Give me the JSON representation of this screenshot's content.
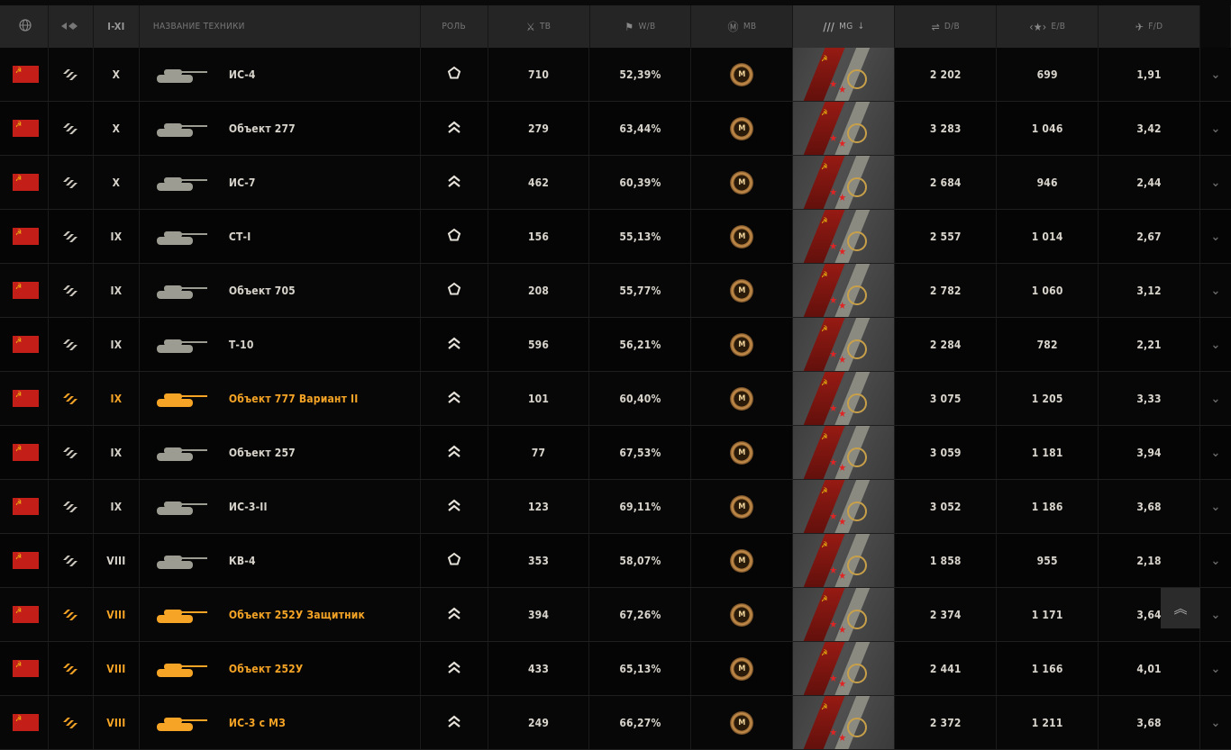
{
  "header": {
    "nation_icon": "globe-icon",
    "type_icon": "vehicle-type-icon",
    "tier_label": "I-XI",
    "name_label": "Название техники",
    "role_label": "Роль",
    "battles_label": "ТВ",
    "winrate_label": "W/B",
    "mastery_label": "MB",
    "marks_label": "MG",
    "damage_label": "D/B",
    "exp_label": "E/B",
    "frags_label": "F/D"
  },
  "colors": {
    "premium": "#f5a425",
    "standard": "#d8d4cc",
    "header_bg": "#252525"
  },
  "rows": [
    {
      "tier": "X",
      "name": "ИС-4",
      "role": "heavy-armor",
      "battles": "710",
      "winrate": "52,39%",
      "mastery": "M",
      "damage": "2 202",
      "exp": "699",
      "frags": "1,91",
      "premium": false
    },
    {
      "tier": "X",
      "name": "Объект 277",
      "role": "heavy-assault",
      "battles": "279",
      "winrate": "63,44%",
      "mastery": "M",
      "damage": "3 283",
      "exp": "1 046",
      "frags": "3,42",
      "premium": false
    },
    {
      "tier": "X",
      "name": "ИС-7",
      "role": "heavy-assault",
      "battles": "462",
      "winrate": "60,39%",
      "mastery": "M",
      "damage": "2 684",
      "exp": "946",
      "frags": "2,44",
      "premium": false
    },
    {
      "tier": "IX",
      "name": "СТ-I",
      "role": "heavy-armor",
      "battles": "156",
      "winrate": "55,13%",
      "mastery": "M",
      "damage": "2 557",
      "exp": "1 014",
      "frags": "2,67",
      "premium": false
    },
    {
      "tier": "IX",
      "name": "Объект 705",
      "role": "heavy-armor",
      "battles": "208",
      "winrate": "55,77%",
      "mastery": "M",
      "damage": "2 782",
      "exp": "1 060",
      "frags": "3,12",
      "premium": false
    },
    {
      "tier": "IX",
      "name": "Т-10",
      "role": "heavy-assault",
      "battles": "596",
      "winrate": "56,21%",
      "mastery": "M",
      "damage": "2 284",
      "exp": "782",
      "frags": "2,21",
      "premium": false
    },
    {
      "tier": "IX",
      "name": "Объект 777 Вариант II",
      "role": "heavy-assault",
      "battles": "101",
      "winrate": "60,40%",
      "mastery": "M",
      "damage": "3 075",
      "exp": "1 205",
      "frags": "3,33",
      "premium": true
    },
    {
      "tier": "IX",
      "name": "Объект 257",
      "role": "heavy-assault",
      "battles": "77",
      "winrate": "67,53%",
      "mastery": "M",
      "damage": "3 059",
      "exp": "1 181",
      "frags": "3,94",
      "premium": false
    },
    {
      "tier": "IX",
      "name": "ИС-3-II",
      "role": "heavy-assault",
      "battles": "123",
      "winrate": "69,11%",
      "mastery": "M",
      "damage": "3 052",
      "exp": "1 186",
      "frags": "3,68",
      "premium": false
    },
    {
      "tier": "VIII",
      "name": "КВ-4",
      "role": "heavy-armor",
      "battles": "353",
      "winrate": "58,07%",
      "mastery": "M",
      "damage": "1 858",
      "exp": "955",
      "frags": "2,18",
      "premium": false
    },
    {
      "tier": "VIII",
      "name": "Объект 252У Защитник",
      "role": "heavy-assault",
      "battles": "394",
      "winrate": "67,26%",
      "mastery": "M",
      "damage": "2 374",
      "exp": "1 171",
      "frags": "3,64",
      "premium": true
    },
    {
      "tier": "VIII",
      "name": "Объект 252У",
      "role": "heavy-assault",
      "battles": "433",
      "winrate": "65,13%",
      "mastery": "M",
      "damage": "2 441",
      "exp": "1 166",
      "frags": "4,01",
      "premium": true
    },
    {
      "tier": "VIII",
      "name": "ИС-3 с МЗ",
      "role": "heavy-assault",
      "battles": "249",
      "winrate": "66,27%",
      "mastery": "M",
      "damage": "2 372",
      "exp": "1 211",
      "frags": "3,68",
      "premium": true
    }
  ],
  "scroll_top_icon": "double-chevron-up-icon"
}
